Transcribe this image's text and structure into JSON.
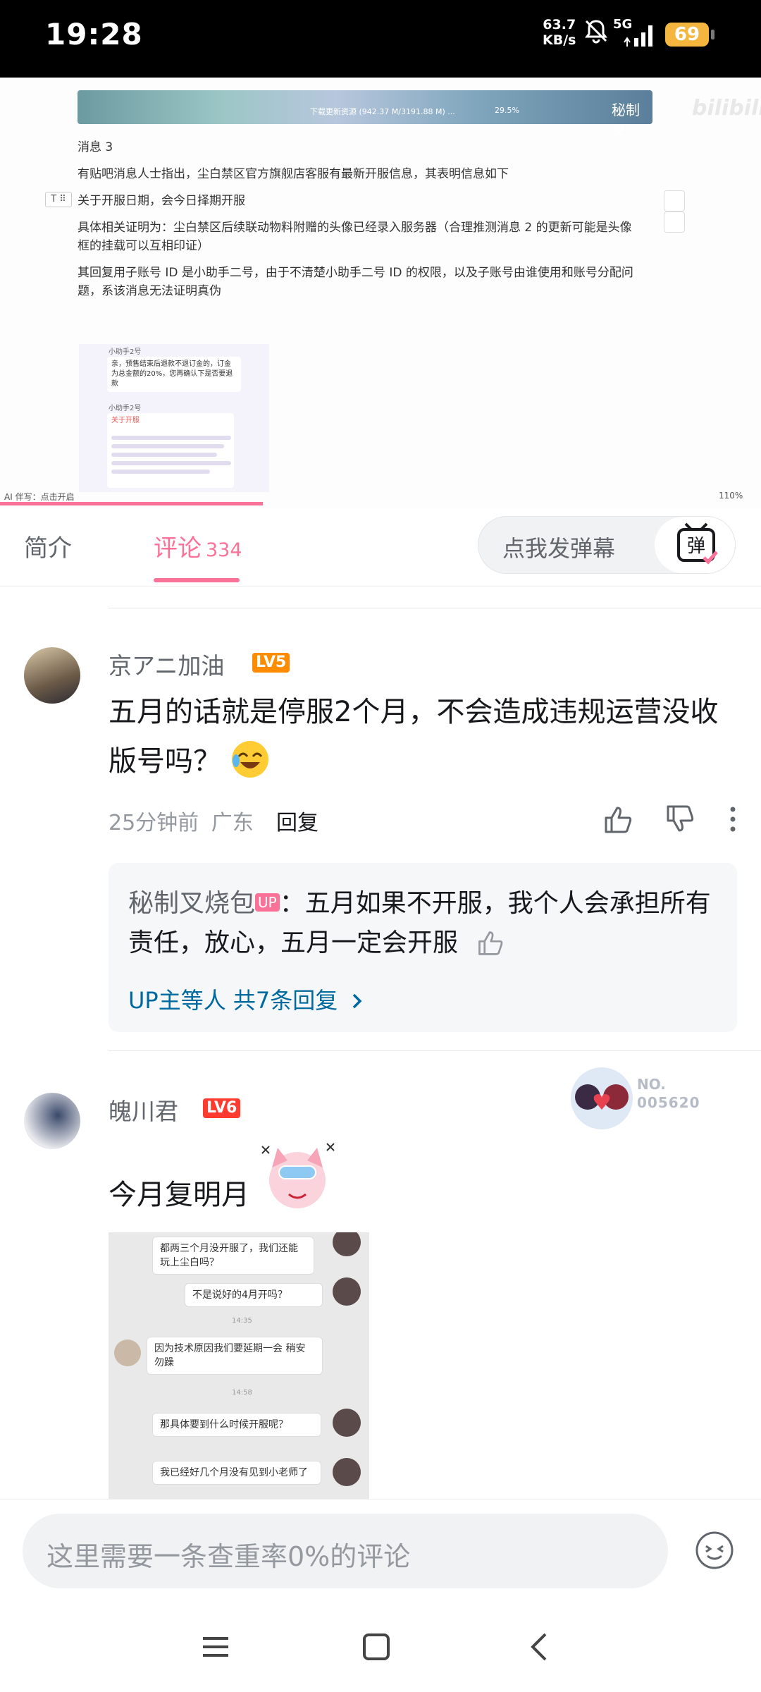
{
  "status_bar": {
    "time": "19:28",
    "speed_value": "63.7",
    "speed_unit": "KB/s",
    "network": "5G",
    "battery": "69"
  },
  "video": {
    "download_text": "下载更新资源 (942.37 M/3191.88 M) ...",
    "download_pct": "29.5%",
    "uploader_watermark": "秘制叉",
    "site_watermark": "bilibili",
    "doc_lines": [
      "消息 3",
      "有贴吧消息人士指出，尘白禁区官方旗舰店客服有最新开服信息，其表明信息如下",
      "关于开服日期，会今日择期开服",
      "具体相关证明为：尘白禁区后续联动物料附赠的头像已经录入服务器（合理推测消息 2 的更新可能是头像",
      "框的挂载可以互相印证）",
      "其回复用子账号 ID 是小助手二号，由于不清楚小助手二号 ID 的权限，以及子账号由谁使用和账号分配问",
      "题，系该消息无法证明真伪"
    ],
    "thumb": {
      "name1": "小助手2号",
      "bubble1": "亲，预售结束后退款不退订金的，订金为总金额的20%，您再确认下是否要退款",
      "name2": "小助手2号",
      "heading": "关于开服"
    },
    "ai_label": "AI 伴写：点击开启",
    "zoom": "110%",
    "progress_fraction": 0.345
  },
  "tabs": {
    "intro": "简介",
    "comments": "评论",
    "comments_count": "334",
    "danmaku_placeholder": "点我发弹幕",
    "danmaku_icon_char": "弹"
  },
  "comments": [
    {
      "user": "京アニ加油",
      "level": "LV5",
      "text_line1": "五月的话就是停服2个月，不会造成违规运营没收",
      "text_line2": "版号吗？",
      "time": "25分钟前",
      "location": "广东",
      "reply_label": "回复",
      "reply_preview": {
        "user": "秘制叉烧包",
        "up_tag": "UP",
        "text": "：五月如果不开服，我个人会承担所有责任，放心，五月一定会开服",
        "more": "UP主等人 共7条回复"
      }
    },
    {
      "user": "魄川君",
      "level": "LV6",
      "text": "今月复明月",
      "garb_number": "NO.",
      "garb_serial": "005620",
      "image_chat": {
        "msg1": "都两三个月没开服了，我们还能玩上尘白吗？",
        "msg2": "不是说好的4月开吗？",
        "time1": "14:35",
        "msg3": "因为技术原因我们要延期一会 稍安勿躁",
        "time2": "14:58",
        "msg4": "那具体要到什么时候开服呢？",
        "msg5": "我已经好几个月没有见到小老师了"
      }
    }
  ],
  "input": {
    "placeholder": "这里需要一条查重率0%的评论"
  },
  "colors": {
    "accent": "#fb7299",
    "link": "#00699d",
    "lv5": "#ff8c00",
    "lv6": "#ff3b30"
  }
}
